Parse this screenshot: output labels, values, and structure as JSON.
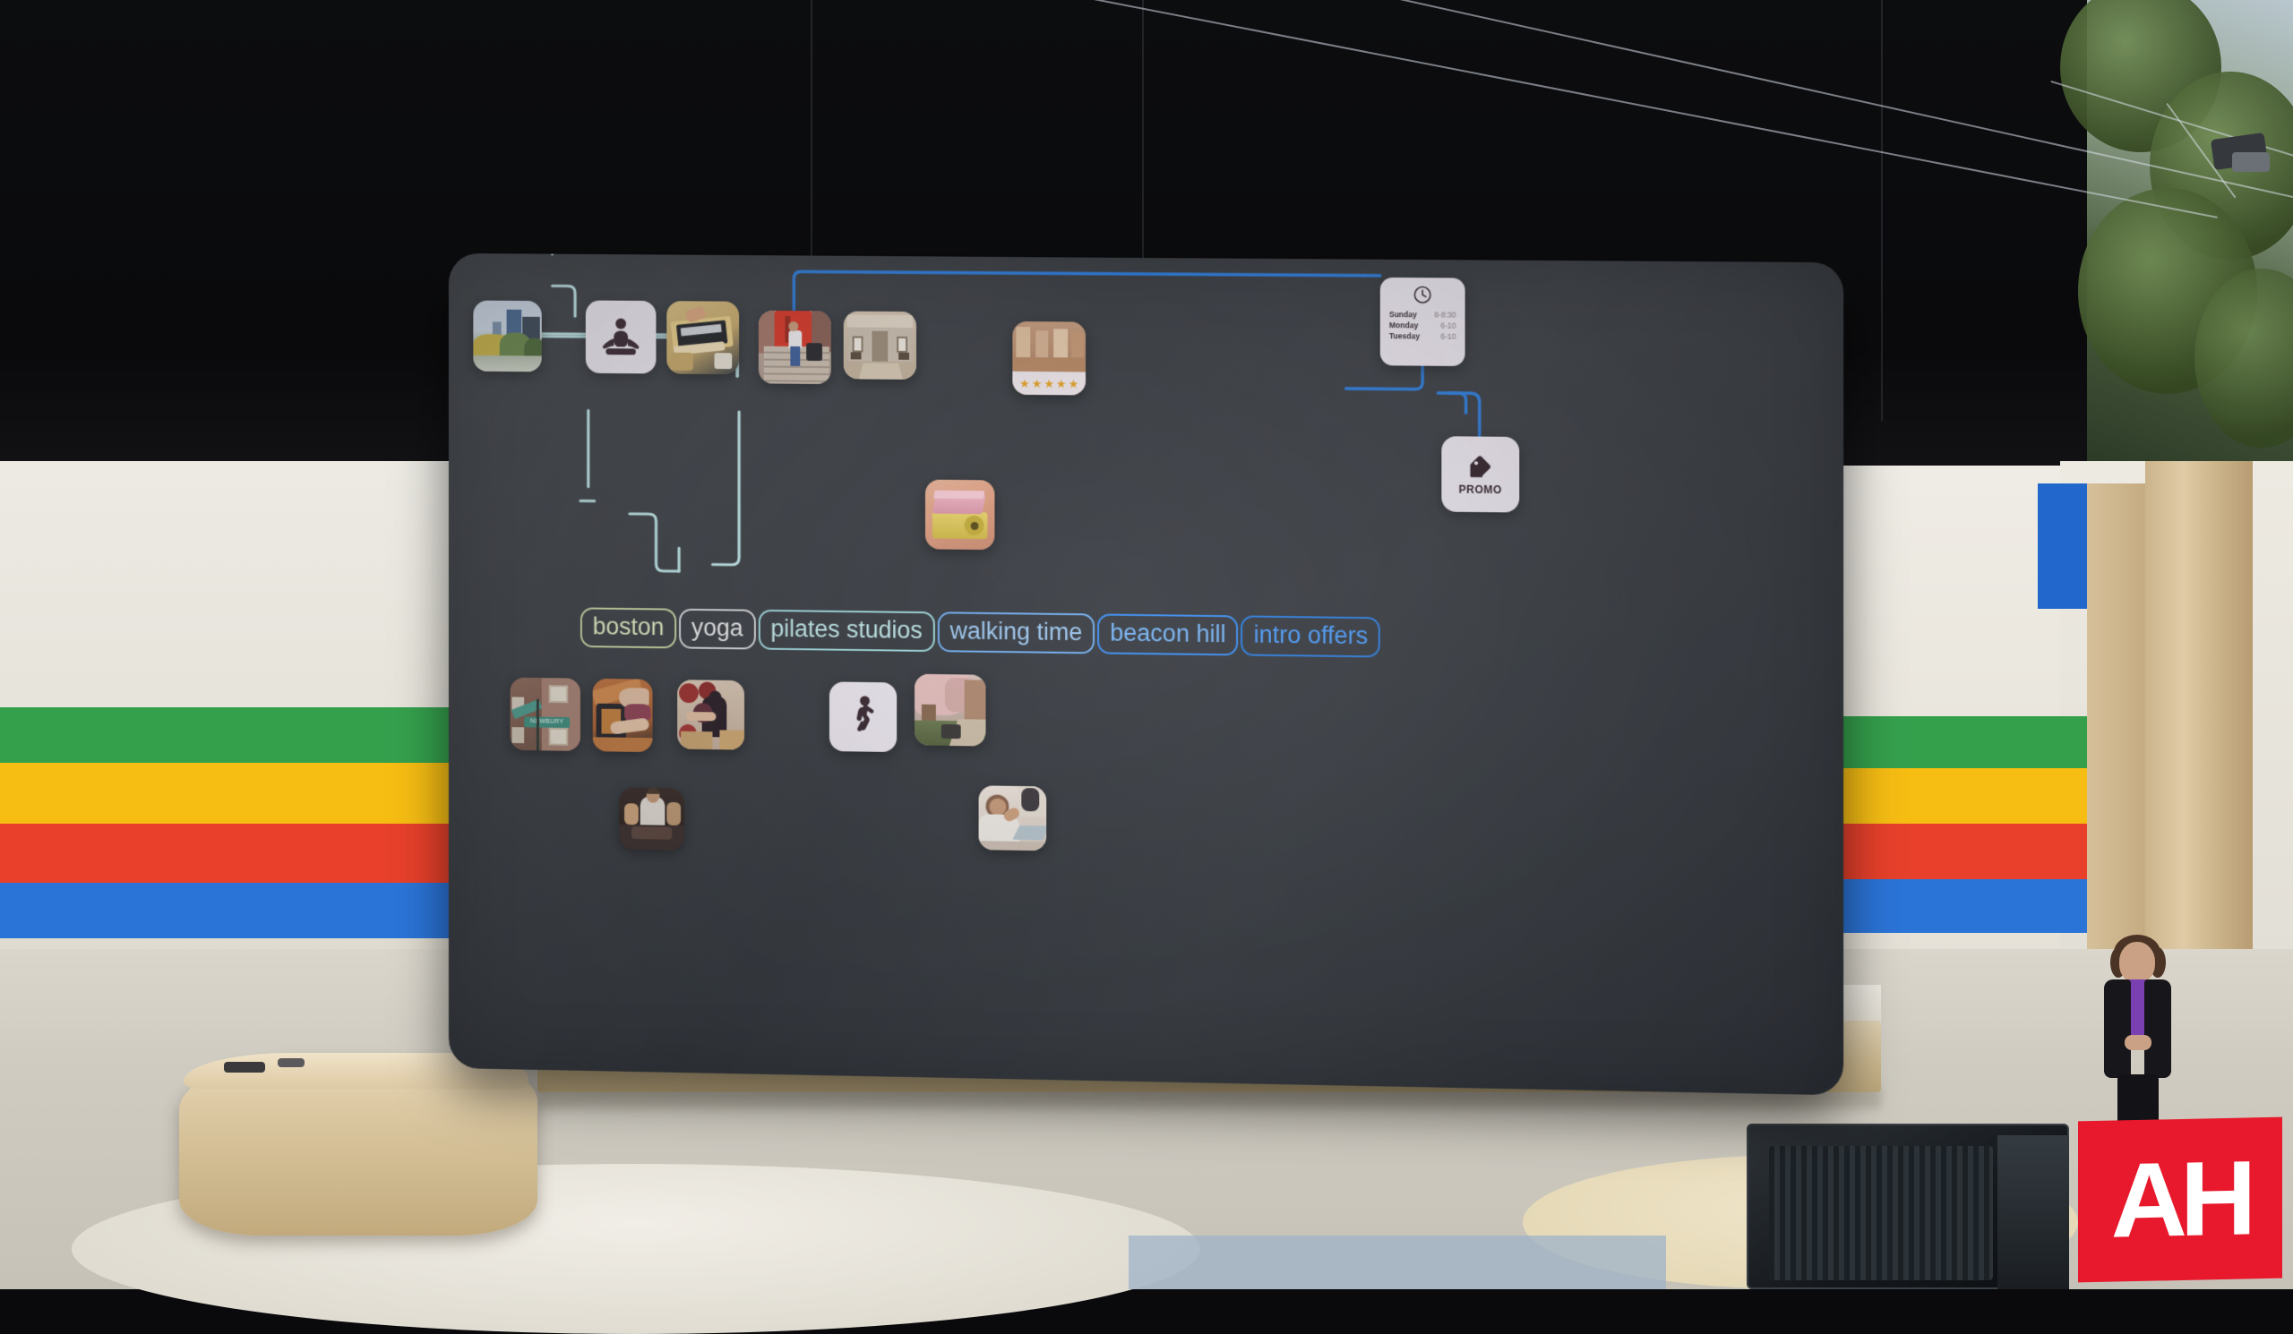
{
  "scene": {
    "title": "Google I/O keynote stage — AI multisearch concept board",
    "venue": "outdoor amphitheater stage",
    "watermark": "AH"
  },
  "board": {
    "background_color": "#3b3f45",
    "link_color_primary": "#bfe6e8",
    "link_color_secondary": "#2f7fe0"
  },
  "chips": [
    {
      "label": "boston",
      "color": "#dfe9c0",
      "border": "#c9d6a4"
    },
    {
      "label": "yoga",
      "color": "#e8e8ea",
      "border": "#d8d8dc"
    },
    {
      "label": "pilates studios",
      "color": "#bfe6e8",
      "border": "#9fd8dc"
    },
    {
      "label": "walking time",
      "color": "#9fc8f0",
      "border": "#74aef0"
    },
    {
      "label": "beacon hill",
      "color": "#79b5f5",
      "border": "#3d8ef2"
    },
    {
      "label": "intro offers",
      "color": "#4f9dfb",
      "border": "#2f7fe0"
    }
  ],
  "hours_card": {
    "icon": "clock-icon",
    "rows": [
      {
        "day": "Sunday",
        "time": "8-8:30"
      },
      {
        "day": "Monday",
        "time": "6-10"
      },
      {
        "day": "Tuesday",
        "time": "6-10"
      }
    ]
  },
  "promo_card": {
    "icon": "price-tag-icon",
    "label": "PROMO"
  },
  "rating": {
    "stars": "★★★★★",
    "count": 5
  },
  "nodes": [
    {
      "name": "boston-skyline-photo",
      "caption": "Boston skyline with Prudential Tower over autumn park"
    },
    {
      "name": "yoga-pose-icon-card",
      "caption": "lotus meditation pose icon"
    },
    {
      "name": "yoga-mat-block-photo",
      "caption": "pink yoga block on rolled yellow mat"
    },
    {
      "name": "pilates-reformer-photo",
      "caption": "pilates reformer machine overhead"
    },
    {
      "name": "red-door-steps-photo",
      "caption": "woman walking down brownstone steps by red door"
    },
    {
      "name": "studio-storefront-photo",
      "caption": "studio glass storefront entrance"
    },
    {
      "name": "studio-interior-rating-photo",
      "caption": "wooden studio interior with 5-star rating"
    },
    {
      "name": "newbury-street-sign-photo",
      "caption": "NEWBURY street sign on brick building"
    },
    {
      "name": "pilates-stretch-photo",
      "caption": "person stretching on pilates equipment"
    },
    {
      "name": "pilates-class-photo",
      "caption": "pilates class with exercise balls"
    },
    {
      "name": "yoga-class-photo",
      "caption": "yoga class cobra pose"
    },
    {
      "name": "walking-person-icon-card",
      "caption": "walking person icon"
    },
    {
      "name": "beacon-hill-blossoms-photo",
      "caption": "Beacon Hill street with cherry blossoms"
    },
    {
      "name": "stretch-class-photo",
      "caption": "smiling woman stretching in class"
    }
  ],
  "stage": {
    "color_bands": [
      "#34a04c",
      "#f6bd12",
      "#e8402a",
      "#2a74d8"
    ],
    "wall_color": "#e9e6dd",
    "wood_color": "#d2bb94",
    "presenter": {
      "name": "presenter",
      "attire": "black blazer over purple top"
    }
  }
}
